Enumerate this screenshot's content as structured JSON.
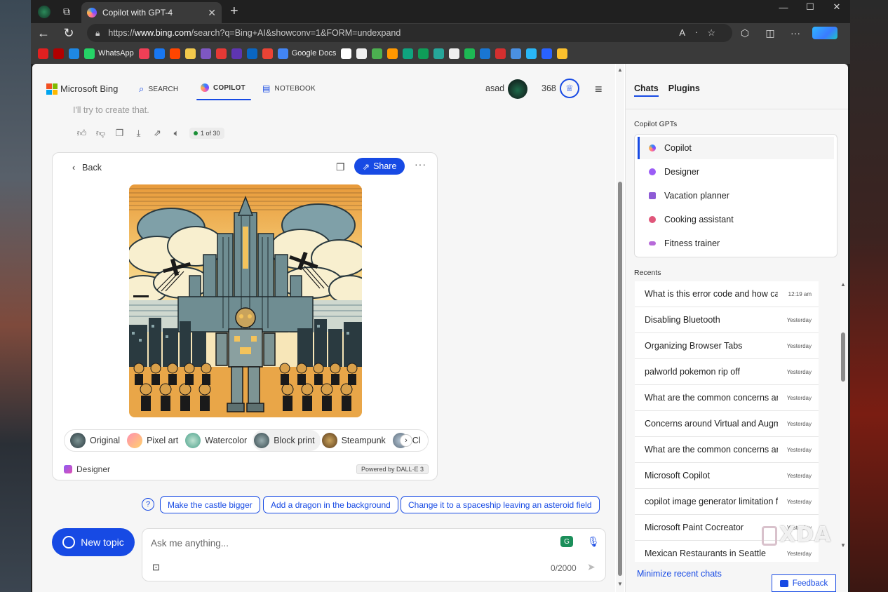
{
  "browser": {
    "tab_title": "Copilot with GPT-4",
    "url_prefix": "https://",
    "url_domain": "www.bing.com",
    "url_rest": "/search?q=Bing+AI&showconv=1&FORM=undexpand",
    "bookmarks": [
      {
        "label": "",
        "color": "#e02020"
      },
      {
        "label": "",
        "color": "#b00000"
      },
      {
        "label": "",
        "color": "#1e88e5"
      },
      {
        "label": "WhatsApp",
        "color": "#25d366"
      },
      {
        "label": "",
        "color": "#ef3f56"
      },
      {
        "label": "",
        "color": "#1877f2"
      },
      {
        "label": "",
        "color": "#ff4500"
      },
      {
        "label": "",
        "color": "#f2c94c"
      },
      {
        "label": "",
        "color": "#7e57c2"
      },
      {
        "label": "",
        "color": "#e53935"
      },
      {
        "label": "",
        "color": "#5e35b1"
      },
      {
        "label": "",
        "color": "#0a66c2"
      },
      {
        "label": "",
        "color": "#ea4335"
      },
      {
        "label": "Google Docs",
        "color": "#4285f4"
      },
      {
        "label": "",
        "color": "#ffffff"
      },
      {
        "label": "",
        "color": "#f0f0f0"
      },
      {
        "label": "",
        "color": "#4caf50"
      },
      {
        "label": "",
        "color": "#ff9800"
      },
      {
        "label": "",
        "color": "#0fa47f"
      },
      {
        "label": "",
        "color": "#0f9d58"
      },
      {
        "label": "",
        "color": "#26a69a"
      },
      {
        "label": "",
        "color": "#eeeeee"
      },
      {
        "label": "",
        "color": "#1db954"
      },
      {
        "label": "",
        "color": "#1976d2"
      },
      {
        "label": "",
        "color": "#d32f2f"
      },
      {
        "label": "",
        "color": "#4a90e2"
      },
      {
        "label": "",
        "color": "#29b6f6"
      },
      {
        "label": "",
        "color": "#2962ff"
      },
      {
        "label": "",
        "color": "#fbc02d"
      }
    ]
  },
  "header": {
    "brand": "Microsoft Bing",
    "nav": [
      {
        "label": "SEARCH",
        "icon": "search-icon"
      },
      {
        "label": "COPILOT",
        "icon": "copilot-icon"
      },
      {
        "label": "NOTEBOOK",
        "icon": "notebook-icon"
      }
    ],
    "user": "asad",
    "points": "368"
  },
  "chat": {
    "faded_text": "I'll try to create that.",
    "counter": "1 of 30",
    "card": {
      "back_label": "Back",
      "share_label": "Share",
      "styles": [
        "Original",
        "Pixel art",
        "Watercolor",
        "Block print",
        "Steampunk",
        "Cl"
      ],
      "designer_label": "Designer",
      "powered_label": "Powered by DALL·E 3"
    },
    "suggestions": [
      "Make the castle bigger",
      "Add a dragon in the background",
      "Change it to a spaceship leaving an asteroid field"
    ],
    "new_topic": "New topic",
    "input_placeholder": "Ask me anything...",
    "char_count": "0/2000"
  },
  "sidebar": {
    "tabs": [
      "Chats",
      "Plugins"
    ],
    "gpts_label": "Copilot GPTs",
    "gpts": [
      {
        "label": "Copilot",
        "color": "#7b4dff"
      },
      {
        "label": "Designer",
        "color": "#9b5cf6"
      },
      {
        "label": "Vacation planner",
        "color": "#8e5bd6"
      },
      {
        "label": "Cooking assistant",
        "color": "#e0567a"
      },
      {
        "label": "Fitness trainer",
        "color": "#b76ad9"
      }
    ],
    "recents_label": "Recents",
    "recents": [
      {
        "title": "What is this error code and how can fi",
        "when": "12:19 am"
      },
      {
        "title": "Disabling Bluetooth",
        "when": "Yesterday"
      },
      {
        "title": "Organizing Browser Tabs",
        "when": "Yesterday"
      },
      {
        "title": "palworld pokemon rip off",
        "when": "Yesterday"
      },
      {
        "title": "What are the common concerns arour",
        "when": "Yesterday"
      },
      {
        "title": "Concerns around Virtual and Augmen",
        "when": "Yesterday"
      },
      {
        "title": "What are the common concerns arour",
        "when": "Yesterday"
      },
      {
        "title": "Microsoft Copilot",
        "when": "Yesterday"
      },
      {
        "title": "copilot image generator limitation for",
        "when": "Yesterday"
      },
      {
        "title": "Microsoft Paint Cocreator",
        "when": "Yesterday"
      },
      {
        "title": "Mexican Restaurants in Seattle",
        "when": "Yesterday"
      }
    ],
    "minimize_label": "Minimize recent chats",
    "feedback_label": "Feedback"
  },
  "watermark": "XDA"
}
